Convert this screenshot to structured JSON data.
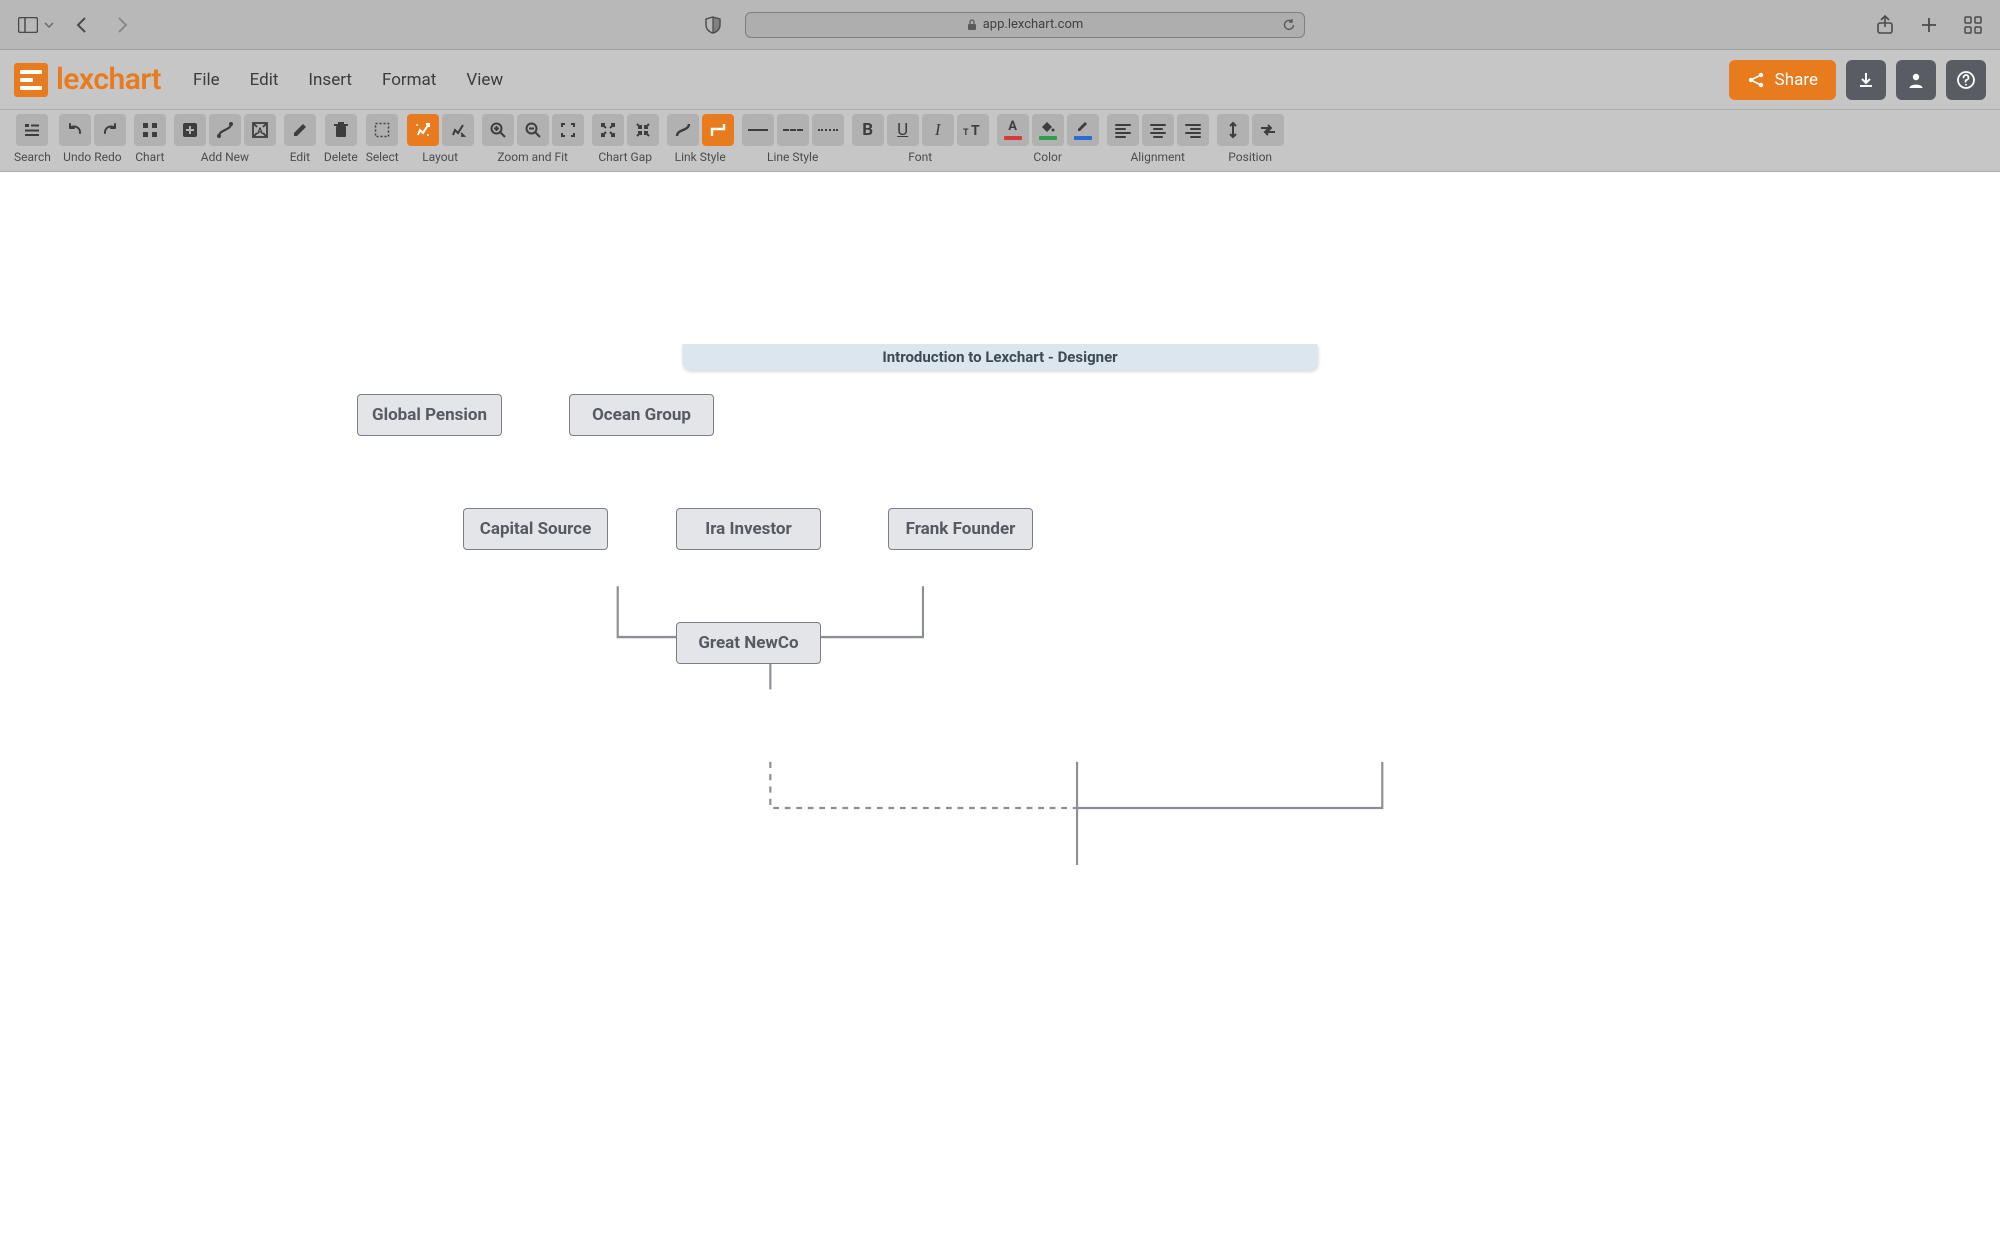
{
  "browser": {
    "url": "app.lexchart.com"
  },
  "app": {
    "logo_text": "lexchart",
    "menus": {
      "file": "File",
      "edit": "Edit",
      "insert": "Insert",
      "format": "Format",
      "view": "View"
    },
    "share_label": "Share"
  },
  "toolbar": {
    "search": "Search",
    "undo": "Undo",
    "redo": "Redo",
    "chart": "Chart",
    "add_new": "Add New",
    "edit": "Edit",
    "delete": "Delete",
    "select": "Select",
    "layout": "Layout",
    "zoom_fit": "Zoom and Fit",
    "chart_gap": "Chart Gap",
    "link_style": "Link Style",
    "line_style": "Line Style",
    "font": "Font",
    "color": "Color",
    "alignment": "Alignment",
    "position": "Position"
  },
  "document": {
    "title": "Introduction to Lexchart - Designer"
  },
  "chart_data": {
    "type": "org-chart",
    "nodes": [
      {
        "id": "global_pension",
        "label": "Global Pension"
      },
      {
        "id": "ocean_group",
        "label": "Ocean Group"
      },
      {
        "id": "capital_source",
        "label": "Capital Source"
      },
      {
        "id": "ira_investor",
        "label": "Ira Investor"
      },
      {
        "id": "frank_founder",
        "label": "Frank Founder"
      },
      {
        "id": "great_newco",
        "label": "Great NewCo"
      }
    ],
    "edges": [
      {
        "from": "global_pension",
        "to": "capital_source",
        "style": "solid"
      },
      {
        "from": "ocean_group",
        "to": "capital_source",
        "style": "solid"
      },
      {
        "from": "capital_source",
        "to": "great_newco",
        "style": "dashed"
      },
      {
        "from": "ira_investor",
        "to": "great_newco",
        "style": "solid"
      },
      {
        "from": "frank_founder",
        "to": "great_newco",
        "style": "solid"
      }
    ]
  }
}
